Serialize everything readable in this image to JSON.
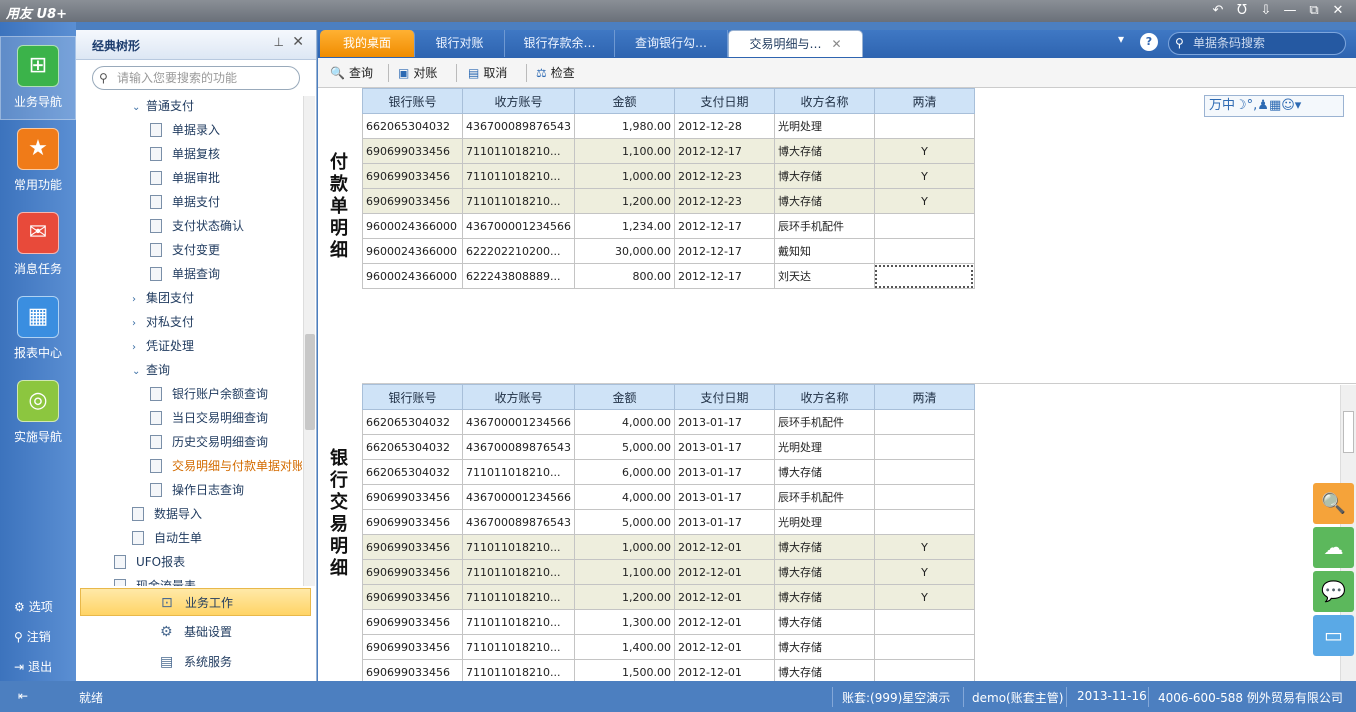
{
  "app": {
    "title": "用友 U8+"
  },
  "window_controls": [
    "↶",
    "Ʊ",
    "⇩",
    "—",
    "⧉",
    "✕"
  ],
  "leftbar": {
    "items": [
      {
        "label": "业务导航",
        "icon": "business-nav-icon",
        "glyph": "⊞"
      },
      {
        "label": "常用功能",
        "icon": "star-icon",
        "glyph": "★"
      },
      {
        "label": "消息任务",
        "icon": "mail-icon",
        "glyph": "✉"
      },
      {
        "label": "报表中心",
        "icon": "report-icon",
        "glyph": "▦"
      },
      {
        "label": "实施导航",
        "icon": "compass-icon",
        "glyph": "◎"
      }
    ],
    "bottom": [
      {
        "label": "选项",
        "glyph": "⚙"
      },
      {
        "label": "注销",
        "glyph": "⚲"
      },
      {
        "label": "退出",
        "glyph": "⇥"
      }
    ]
  },
  "tree": {
    "title": "经典树形",
    "search_placeholder": "请输入您要搜索的功能",
    "items": [
      {
        "label": "普通支付",
        "toggle": "⌄",
        "doc": false
      },
      {
        "label": "单据录入",
        "toggle": "",
        "doc": true
      },
      {
        "label": "单据复核",
        "toggle": "",
        "doc": true
      },
      {
        "label": "单据审批",
        "toggle": "",
        "doc": true
      },
      {
        "label": "单据支付",
        "toggle": "",
        "doc": true
      },
      {
        "label": "支付状态确认",
        "toggle": "",
        "doc": true
      },
      {
        "label": "支付变更",
        "toggle": "",
        "doc": true
      },
      {
        "label": "单据查询",
        "toggle": "",
        "doc": true
      },
      {
        "label": "集团支付",
        "toggle": "›",
        "doc": false
      },
      {
        "label": "对私支付",
        "toggle": "›",
        "doc": false
      },
      {
        "label": "凭证处理",
        "toggle": "›",
        "doc": false
      },
      {
        "label": "查询",
        "toggle": "⌄",
        "doc": false
      },
      {
        "label": "银行账户余额查询",
        "toggle": "",
        "doc": true
      },
      {
        "label": "当日交易明细查询",
        "toggle": "",
        "doc": true
      },
      {
        "label": "历史交易明细查询",
        "toggle": "",
        "doc": true
      },
      {
        "label": "交易明细与付款单据对账",
        "toggle": "",
        "doc": true,
        "selected": true
      },
      {
        "label": "操作日志查询",
        "toggle": "",
        "doc": true
      },
      {
        "label": "数据导入",
        "toggle": "",
        "doc": true
      },
      {
        "label": "自动生单",
        "toggle": "",
        "doc": true
      },
      {
        "label": "UFO报表",
        "toggle": "",
        "doc": true
      },
      {
        "label": "现金流量表",
        "toggle": "",
        "doc": true
      }
    ],
    "bottom_buttons": [
      {
        "label": "业务工作",
        "glyph": "⊡"
      },
      {
        "label": "基础设置",
        "glyph": "⚙"
      },
      {
        "label": "系统服务",
        "glyph": "▤"
      }
    ]
  },
  "tabs": [
    {
      "label": "我的桌面"
    },
    {
      "label": "银行对账"
    },
    {
      "label": "银行存款余…"
    },
    {
      "label": "查询银行勾…"
    },
    {
      "label": "交易明细与…"
    }
  ],
  "header_search": {
    "placeholder": "单据条码搜索"
  },
  "toolbar": [
    {
      "label": "查询",
      "glyph": "🔍"
    },
    {
      "label": "对账",
      "glyph": "▣"
    },
    {
      "label": "取消",
      "glyph": "▤"
    },
    {
      "label": "检查",
      "glyph": "⚖"
    }
  ],
  "ime_bar": "万中☽°,♟▦☺▾",
  "columns": [
    "银行账号",
    "收方账号",
    "金额",
    "支付日期",
    "收方名称",
    "两清"
  ],
  "payment": {
    "label": "付款单明细",
    "rows": [
      [
        "662065304032",
        "436700089876543",
        "1,980.00",
        "2012-12-28",
        "光明处理",
        ""
      ],
      [
        "690699033456",
        "711011018210...",
        "1,100.00",
        "2012-12-17",
        "博大存储",
        "Y"
      ],
      [
        "690699033456",
        "711011018210...",
        "1,000.00",
        "2012-12-23",
        "博大存储",
        "Y"
      ],
      [
        "690699033456",
        "711011018210...",
        "1,200.00",
        "2012-12-23",
        "博大存储",
        "Y"
      ],
      [
        "9600024366000",
        "436700001234566",
        "1,234.00",
        "2012-12-17",
        "辰环手机配件",
        ""
      ],
      [
        "9600024366000",
        "622202210200...",
        "30,000.00",
        "2012-12-17",
        "戴知知",
        ""
      ],
      [
        "9600024366000",
        "622243808889...",
        "800.00",
        "2012-12-17",
        "刘天达",
        ""
      ]
    ]
  },
  "bank": {
    "label": "银行交易明细",
    "rows": [
      [
        "662065304032",
        "436700001234566",
        "4,000.00",
        "2013-01-17",
        "辰环手机配件",
        ""
      ],
      [
        "662065304032",
        "436700089876543",
        "5,000.00",
        "2013-01-17",
        "光明处理",
        ""
      ],
      [
        "662065304032",
        "711011018210...",
        "6,000.00",
        "2013-01-17",
        "博大存储",
        ""
      ],
      [
        "690699033456",
        "436700001234566",
        "4,000.00",
        "2013-01-17",
        "辰环手机配件",
        ""
      ],
      [
        "690699033456",
        "436700089876543",
        "5,000.00",
        "2013-01-17",
        "光明处理",
        ""
      ],
      [
        "690699033456",
        "711011018210...",
        "1,000.00",
        "2012-12-01",
        "博大存储",
        "Y"
      ],
      [
        "690699033456",
        "711011018210...",
        "1,100.00",
        "2012-12-01",
        "博大存储",
        "Y"
      ],
      [
        "690699033456",
        "711011018210...",
        "1,200.00",
        "2012-12-01",
        "博大存储",
        "Y"
      ],
      [
        "690699033456",
        "711011018210...",
        "1,300.00",
        "2012-12-01",
        "博大存储",
        ""
      ],
      [
        "690699033456",
        "711011018210...",
        "1,400.00",
        "2012-12-01",
        "博大存储",
        ""
      ],
      [
        "690699033456",
        "711011018210...",
        "1,500.00",
        "2012-12-01",
        "博大存储",
        ""
      ]
    ]
  },
  "side_buttons": [
    {
      "icon": "search-icon",
      "glyph": "🔍",
      "color": "#f5a33a"
    },
    {
      "icon": "cloud-icon",
      "glyph": "☁",
      "color": "#5cb85c"
    },
    {
      "icon": "chat-icon",
      "glyph": "💬",
      "color": "#5cb85c"
    },
    {
      "icon": "message-icon",
      "glyph": "▭",
      "color": "#5aa9e6"
    }
  ],
  "status": {
    "ready": "就绪",
    "account": "账套:(999)星空演示",
    "user": "demo(账套主管)",
    "date": "2013-11-16",
    "company": "4006-600-588 例外贸易有限公司"
  },
  "colors": {
    "accent": "#2e64b0",
    "home_tab": "#f08c00",
    "matched_row": "#eeeedd",
    "header": "#cfe3f7"
  }
}
